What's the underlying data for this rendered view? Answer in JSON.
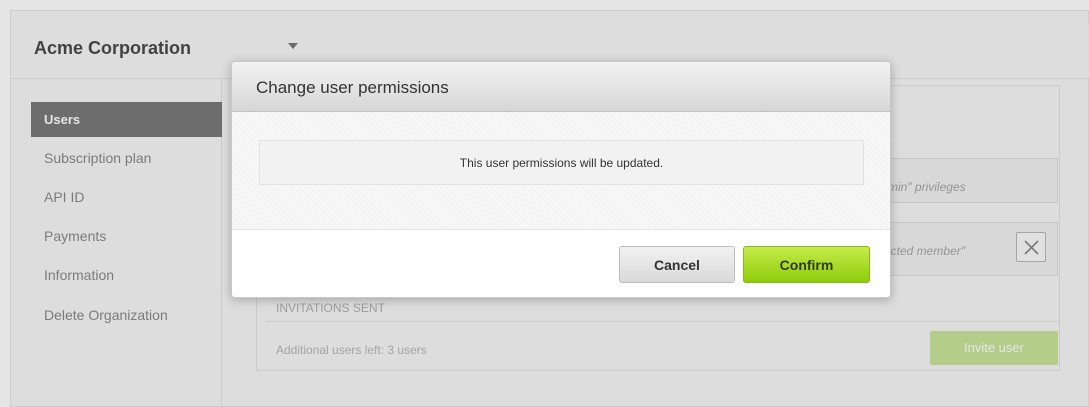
{
  "org": {
    "name": "Acme Corporation"
  },
  "sidebar": {
    "items": [
      {
        "label": "Users",
        "active": true
      },
      {
        "label": "Subscription plan"
      },
      {
        "label": "API ID"
      },
      {
        "label": "Payments"
      },
      {
        "label": "Information"
      },
      {
        "label": "Delete Organization"
      }
    ]
  },
  "members": {
    "admin_text": "min\" privileges",
    "restricted_text": "icted member\""
  },
  "invitations": {
    "heading": "INVITATIONS SENT",
    "users_left": "Additional users left: 3 users",
    "invite_button": "Invite user"
  },
  "modal": {
    "title": "Change user permissions",
    "message": "This user permissions will be updated.",
    "cancel_label": "Cancel",
    "confirm_label": "Confirm"
  },
  "colors": {
    "accent_green": "#9bd615",
    "sidebar_active": "#7a7a7a"
  }
}
